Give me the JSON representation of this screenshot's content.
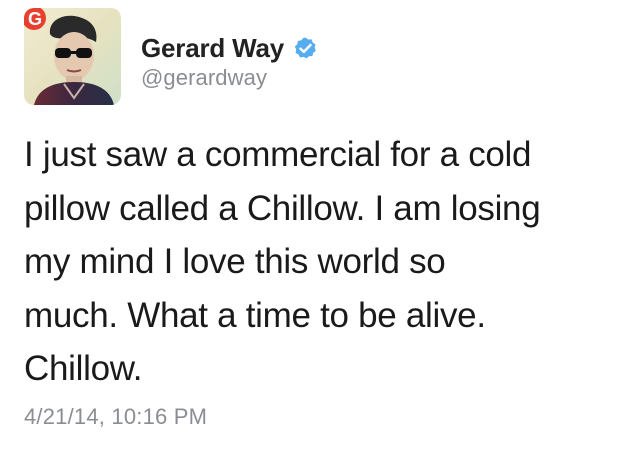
{
  "tweet": {
    "author": {
      "display_name": "Gerard Way",
      "handle": "@gerardway",
      "verified": true,
      "avatar_badge_letter": "G"
    },
    "text_lines": [
      "I just saw a commercial for a cold",
      "pillow called a Chillow. I am losing",
      "my mind I love this world so",
      "much. What a time to be alive.",
      "Chillow."
    ],
    "timestamp": "4/21/14, 10:16 PM"
  },
  "colors": {
    "verified_badge": "#55acee",
    "secondary_text": "#8a8d91",
    "primary_text": "#1a1a1a",
    "avatar_badge": "#e8402f"
  },
  "icons": {
    "verified": "verified-check-icon"
  }
}
